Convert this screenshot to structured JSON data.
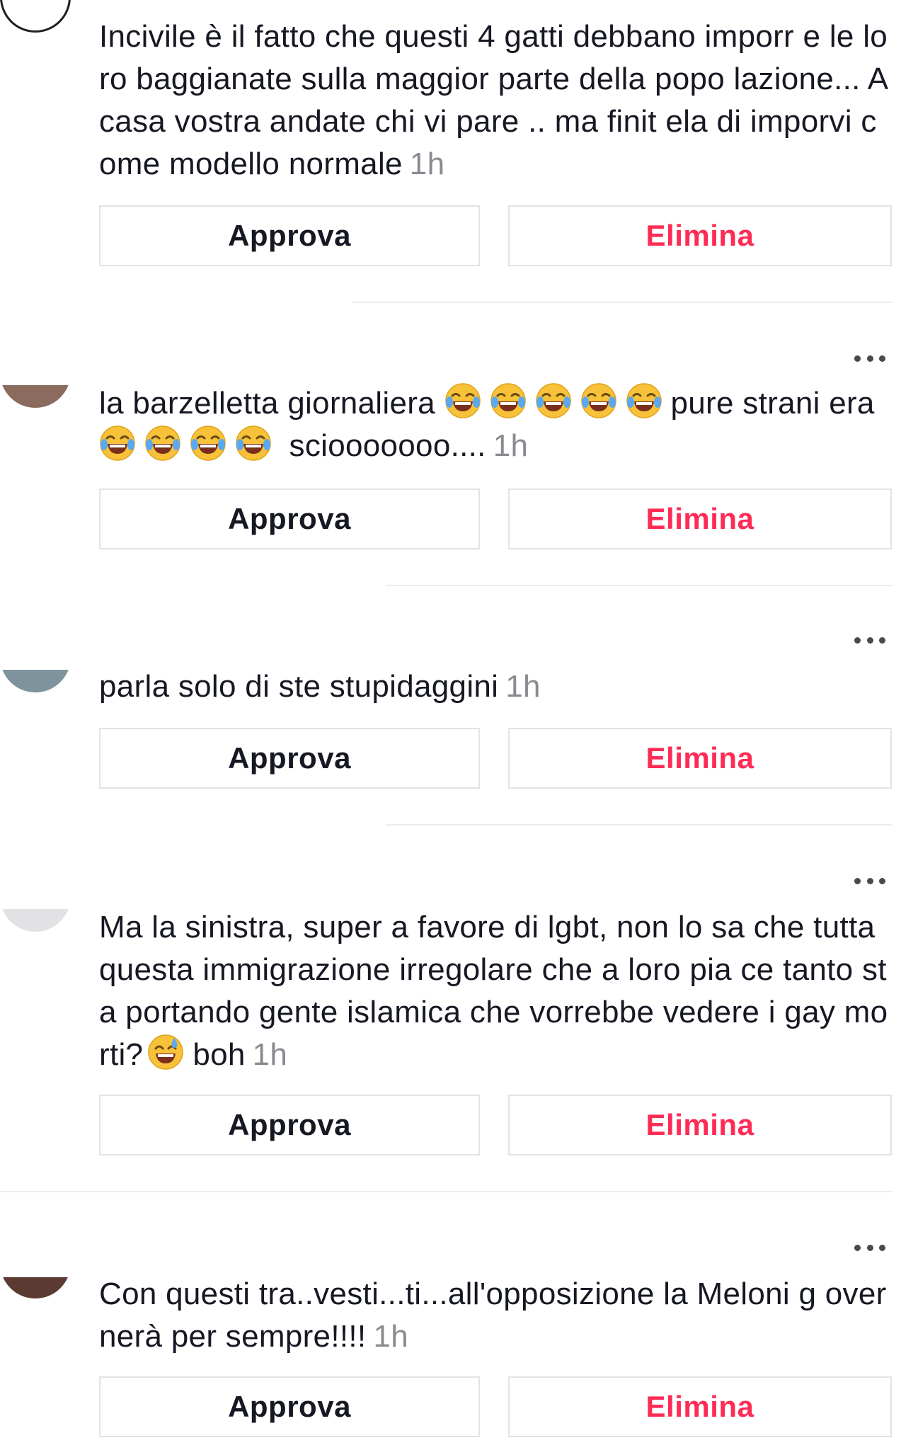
{
  "comments": [
    {
      "text": "Incivile è il fatto che questi 4 gatti debbano imporr e le loro baggianate sulla maggior parte della popo lazione... A casa vostra andate chi vi pare .. ma finit ela di imporvi come modello normale",
      "time": "1h",
      "avatar_color": "#1f1f1f",
      "approve_label": "Approva",
      "delete_label": "Elimina"
    },
    {
      "text_a": "la barzelletta giornaliera",
      "text_b": "pure strani era",
      "text_c": "sciooooooo....",
      "time": "1h",
      "avatar_color": "#8a6b5e",
      "approve_label": "Approva",
      "delete_label": "Elimina"
    },
    {
      "text": "parla solo di ste stupidaggini",
      "time": "1h",
      "avatar_color": "#7f939d",
      "approve_label": "Approva",
      "delete_label": "Elimina"
    },
    {
      "text_a": "Ma la sinistra, super a favore di lgbt, non lo sa che tutta questa immigrazione irregolare che a loro pia ce tanto sta portando gente islamica che vorrebbe vedere i gay morti?",
      "text_b": "boh",
      "time": "1h",
      "avatar_color": "#d4d4d6",
      "approve_label": "Approva",
      "delete_label": "Elimina"
    },
    {
      "text": "Con questi tra..vesti...ti...all'opposizione la Meloni g overnerà per sempre!!!!",
      "time": "1h",
      "avatar_color": "#5b3a32",
      "approve_label": "Approva",
      "delete_label": "Elimina"
    }
  ],
  "icons": {
    "more": "more-options-icon",
    "laugh_emoji": "face-with-tears-of-joy-icon",
    "sweat_emoji": "grinning-face-with-sweat-icon"
  },
  "colors": {
    "delete_text": "#fe2c55",
    "time_text": "#8a8b91",
    "button_border": "#e3e3e4"
  }
}
